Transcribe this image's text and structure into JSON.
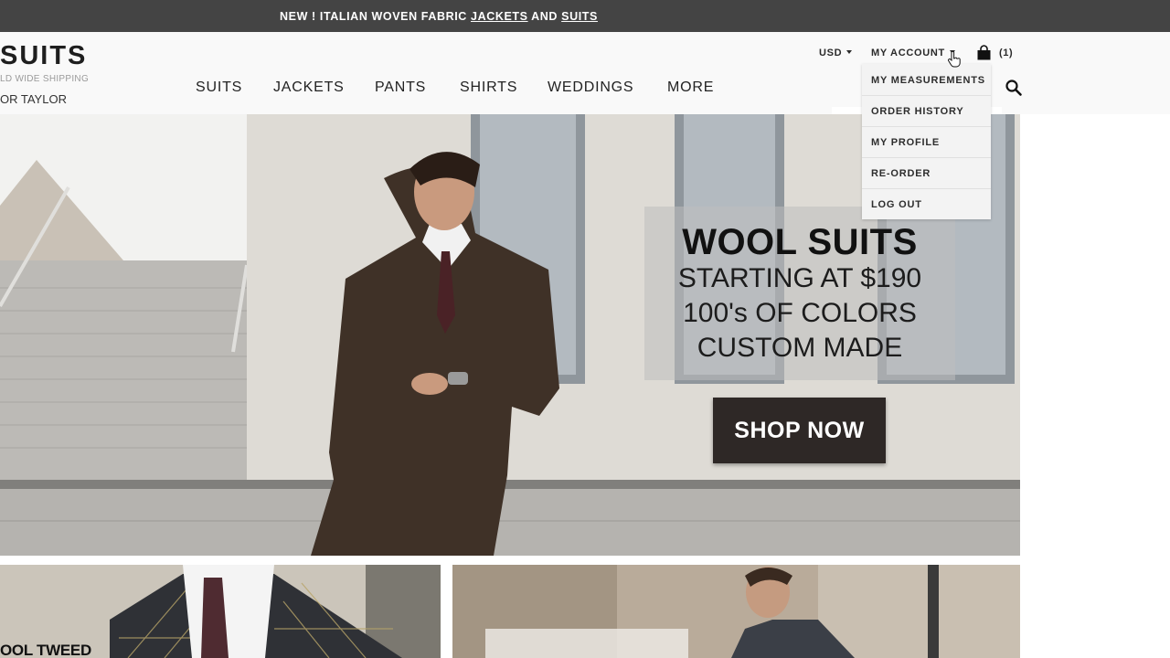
{
  "promo": {
    "prefix": "NEW ! ITALIAN WOVEN FABRIC ",
    "link_jackets": "JACKETS",
    "conjunction": " AND ",
    "link_suits": "SUITS"
  },
  "header": {
    "logo_main": "SUITS",
    "logo_sub": "LD WIDE SHIPPING",
    "logo_tag": "OR TAYLOR",
    "nav": [
      "SUITS",
      "JACKETS",
      "PANTS",
      "SHIRTS",
      "WEDDINGS",
      "MORE"
    ],
    "currency": "USD",
    "account_label": "MY ACCOUNT",
    "cart_count": "(1)",
    "search_placeholder": ""
  },
  "account_menu": {
    "items": [
      "MY MEASUREMENTS",
      "ORDER HISTORY",
      "MY PROFILE",
      "RE-ORDER",
      "LOG OUT"
    ]
  },
  "hero": {
    "title": "WOOL SUITS",
    "line1": "STARTING AT $190",
    "line2": "100's OF COLORS",
    "line3": "CUSTOM MADE",
    "cta": "SHOP NOW"
  },
  "tiles": {
    "left_label": "OOL TWEED"
  },
  "colors": {
    "promo_bar": "#444444",
    "header_bg": "#f9f9f9",
    "dropdown_bg": "#f3f3f3",
    "cta_bg": "#2e2826"
  },
  "icons": {
    "cart": "shopping-bag-icon",
    "search": "magnifier-icon",
    "caret": "caret-down-icon",
    "cursor": "hand-pointer-icon"
  }
}
